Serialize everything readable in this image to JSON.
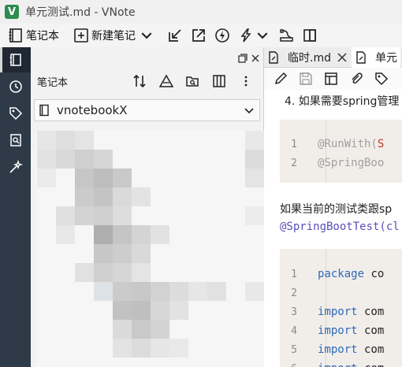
{
  "window": {
    "title": "单元测试.md - VNote",
    "logo_letter": "V"
  },
  "toolbar": {
    "notebook_label": "笔记本",
    "new_note_label": "新建笔记",
    "icons": [
      "notebook-icon",
      "new-note-icon",
      "chevron-down-icon",
      "import-icon",
      "export-icon",
      "sync-icon",
      "flash-icon",
      "chevron-down-icon",
      "tools-icon",
      "split-icon"
    ]
  },
  "activity_bar": {
    "items": [
      "notebook-explorer-icon",
      "history-icon",
      "tag-icon",
      "search-icon",
      "snippet-icon"
    ],
    "active_index": 0
  },
  "notebook_panel": {
    "title": "笔记本",
    "selected_notebook": "vnotebookX",
    "tools": [
      "sort-icon",
      "new-folder-icon",
      "locate-icon",
      "view-icon",
      "more-icon"
    ]
  },
  "editor": {
    "tabs": [
      {
        "label": "临时.md",
        "active": false
      },
      {
        "label": "单元",
        "active": true
      }
    ],
    "tools": [
      "edit-icon",
      "save-icon",
      "outline-icon",
      "attachment-icon",
      "tag-icon"
    ],
    "content": {
      "list_item": "4. 如果需要spring管理",
      "code_block_1": [
        {
          "num": "1",
          "text": "@RunWith(S"
        },
        {
          "num": "2",
          "text": "@SpringBoo"
        }
      ],
      "paragraph": "如果当前的测试类跟sp",
      "inline_code": "@SpringBootTest(cl",
      "code_block_2": [
        {
          "num": "1",
          "text": "package co"
        },
        {
          "num": "2",
          "text": ""
        },
        {
          "num": "3",
          "text": "import com"
        },
        {
          "num": "4",
          "text": "import com"
        },
        {
          "num": "5",
          "text": "import com"
        },
        {
          "num": "6",
          "text": "import com"
        }
      ]
    }
  },
  "colors": {
    "activity_bar": "#2e3a48",
    "annotation": "#a0a0a0",
    "red_fragment": "#c0392b",
    "keyword": "#2e69b8",
    "inline_code": "#5b4fb7",
    "code_bg": "#f1eeea",
    "logo": "#2c8d4d"
  }
}
